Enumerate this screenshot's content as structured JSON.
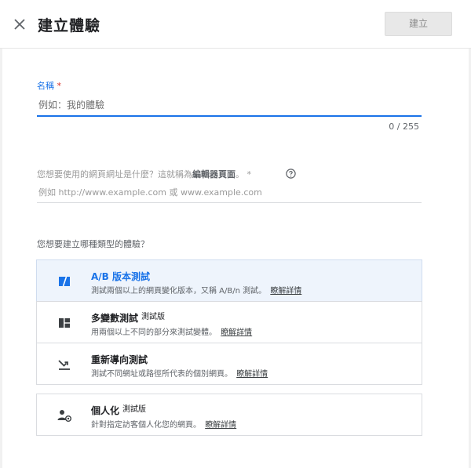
{
  "header": {
    "title": "建立體驗",
    "create_label": "建立"
  },
  "name_field": {
    "label": "名稱",
    "required_mark": "*",
    "placeholder": "例如：我的體驗",
    "value": "",
    "counter": "0 / 255"
  },
  "url_field": {
    "question_prefix": "您想要使用的網頁網址是什麼？這就稱為",
    "question_bold": "編輯器頁面",
    "question_suffix": "。 *",
    "placeholder": "例如 http://www.example.com 或 www.example.com",
    "value": ""
  },
  "type_question": "您想要建立哪種類型的體驗？",
  "options": [
    {
      "title": "A/B 版本測試",
      "beta": "",
      "description": "測試兩個以上的網頁變化版本，又稱 A/B/n 測試。",
      "learn_more": "瞭解詳情",
      "icon": "ab-test-icon",
      "selected": true
    },
    {
      "title": "多變數測試",
      "beta": "測試版",
      "description": "用兩個以上不同的部分來測試變體。",
      "learn_more": "瞭解詳情",
      "icon": "multivariate-icon",
      "selected": false
    },
    {
      "title": "重新導向測試",
      "beta": "",
      "description": "測試不同網址或路徑所代表的個別網頁。",
      "learn_more": "瞭解詳情",
      "icon": "redirect-icon",
      "selected": false
    },
    {
      "title": "個人化",
      "beta": "測試版",
      "description": "針對指定訪客個人化您的網頁。",
      "learn_more": "瞭解詳情",
      "icon": "personalization-icon",
      "selected": false
    }
  ],
  "colors": {
    "accent": "#1a73e8",
    "required": "#d93025",
    "selected_bg": "#eef4fc",
    "icon": "#3c4043"
  }
}
